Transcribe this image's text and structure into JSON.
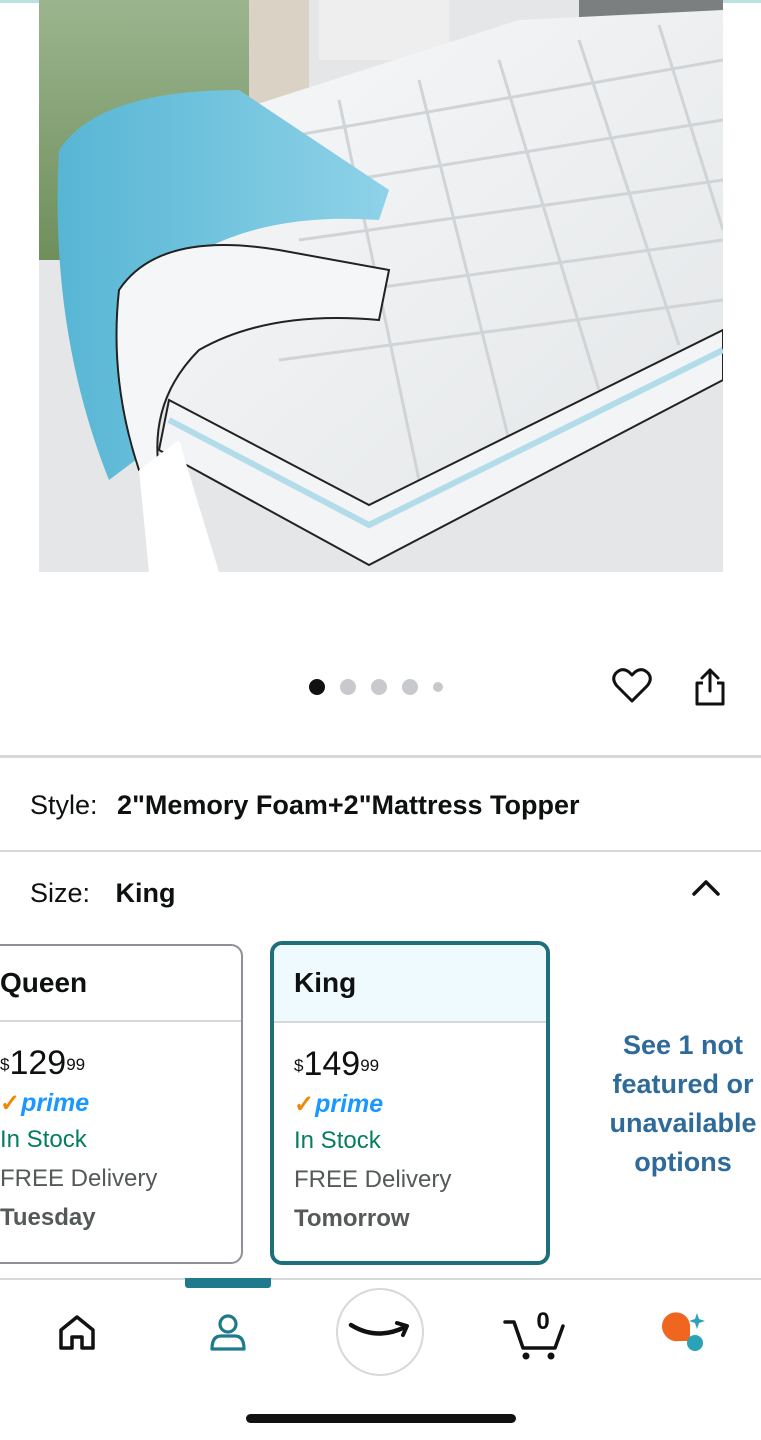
{
  "product": {
    "image_alt": "Mattress topper with memory foam layer",
    "carousel": {
      "total_dots": 5,
      "active_index": 0
    }
  },
  "actions": {
    "wishlist_icon": "heart-icon",
    "share_icon": "share-icon"
  },
  "style": {
    "label": "Style:",
    "value": "2\"Memory Foam+2\"Mattress Topper"
  },
  "size": {
    "label": "Size:",
    "value": "King",
    "toggle_icon": "chevron-up-icon"
  },
  "size_options": [
    {
      "name": "Queen",
      "price_symbol": "$",
      "price_whole": "129",
      "price_fraction": "99",
      "prime_check": "✓",
      "prime_label": "prime",
      "stock": "In Stock",
      "delivery": "FREE Delivery",
      "delivery_day": "Tuesday",
      "selected": false
    },
    {
      "name": "King",
      "price_symbol": "$",
      "price_whole": "149",
      "price_fraction": "99",
      "prime_check": "✓",
      "prime_label": "prime",
      "stock": "In Stock",
      "delivery": "FREE Delivery",
      "delivery_day": "Tomorrow",
      "selected": true
    }
  ],
  "see_more": "See 1 not featured or unavailable options",
  "tabbar": {
    "items": [
      "home-icon",
      "account-icon",
      "amazon-smile-icon",
      "cart-icon",
      "menu-icon"
    ],
    "cart_count": "0",
    "active_index": 1
  },
  "colors": {
    "accent": "#1e6f7c",
    "link": "#2f6b9a",
    "in_stock": "#067d62",
    "prime_blue": "#1a98ff",
    "prime_check": "#f08804"
  }
}
